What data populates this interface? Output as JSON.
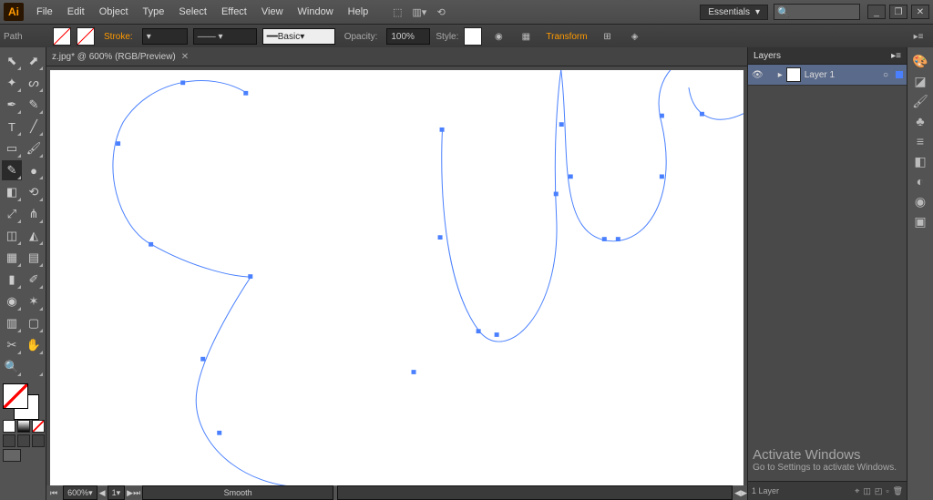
{
  "menu": [
    "File",
    "Edit",
    "Object",
    "Type",
    "Select",
    "Effect",
    "View",
    "Window",
    "Help"
  ],
  "workspaceLabel": "Essentials",
  "winBtns": [
    "_",
    "❐",
    "✕"
  ],
  "control": {
    "leftLabel": "Path",
    "stroke": "Stroke:",
    "basic": "Basic",
    "opacity": "Opacity:",
    "opacityVal": "100%",
    "style": "Style:",
    "transform": "Transform"
  },
  "docTitle": "z.jpg* @ 600% (RGB/Preview)",
  "zoom": "600%",
  "page": "1",
  "smooth": "Smooth",
  "layersTitle": "Layers",
  "layerName": "Layer 1",
  "layerCount": "1 Layer",
  "activate": {
    "t1": "Activate Windows",
    "t2": "Go to Settings to activate Windows."
  },
  "tools": [
    {
      "n": "selection-tool",
      "g": "⬉"
    },
    {
      "n": "direct-selection-tool",
      "g": "⬈"
    },
    {
      "n": "magic-wand-tool",
      "g": "✦"
    },
    {
      "n": "lasso-tool",
      "g": "ᔕ"
    },
    {
      "n": "pen-tool",
      "g": "✒"
    },
    {
      "n": "curvature-tool",
      "g": "✎"
    },
    {
      "n": "type-tool",
      "g": "T"
    },
    {
      "n": "line-tool",
      "g": "╱"
    },
    {
      "n": "rectangle-tool",
      "g": "▭"
    },
    {
      "n": "paintbrush-tool",
      "g": "🖌"
    },
    {
      "n": "pencil-tool",
      "g": "✎",
      "sel": true
    },
    {
      "n": "blob-brush-tool",
      "g": "●"
    },
    {
      "n": "eraser-tool",
      "g": "◧"
    },
    {
      "n": "rotate-tool",
      "g": "⟲"
    },
    {
      "n": "scale-tool",
      "g": "⤢"
    },
    {
      "n": "width-tool",
      "g": "⋔"
    },
    {
      "n": "free-transform-tool",
      "g": "◫"
    },
    {
      "n": "shape-builder-tool",
      "g": "◭"
    },
    {
      "n": "perspective-tool",
      "g": "▦"
    },
    {
      "n": "mesh-tool",
      "g": "▤"
    },
    {
      "n": "gradient-tool",
      "g": "▮"
    },
    {
      "n": "eyedropper-tool",
      "g": "✐"
    },
    {
      "n": "blend-tool",
      "g": "◉"
    },
    {
      "n": "symbol-sprayer-tool",
      "g": "✶"
    },
    {
      "n": "column-graph-tool",
      "g": "▥"
    },
    {
      "n": "artboard-tool",
      "g": "▢"
    },
    {
      "n": "slice-tool",
      "g": "✂"
    },
    {
      "n": "hand-tool",
      "g": "✋"
    },
    {
      "n": "zoom-tool",
      "g": "🔍"
    },
    {
      "n": "blank-tool",
      "g": ""
    }
  ],
  "dock": [
    {
      "n": "color-icon",
      "g": "🎨"
    },
    {
      "n": "swatches-icon",
      "g": "◪"
    },
    {
      "n": "brushes-icon",
      "g": "🖌"
    },
    {
      "n": "symbols-icon",
      "g": "♣"
    },
    {
      "n": "stroke-icon",
      "g": "≡"
    },
    {
      "n": "gradient-icon",
      "g": "◧"
    },
    {
      "n": "transparency-icon",
      "g": "◐"
    },
    {
      "n": "appearance-icon",
      "g": "◉"
    },
    {
      "n": "graphic-styles-icon",
      "g": "▣"
    }
  ]
}
